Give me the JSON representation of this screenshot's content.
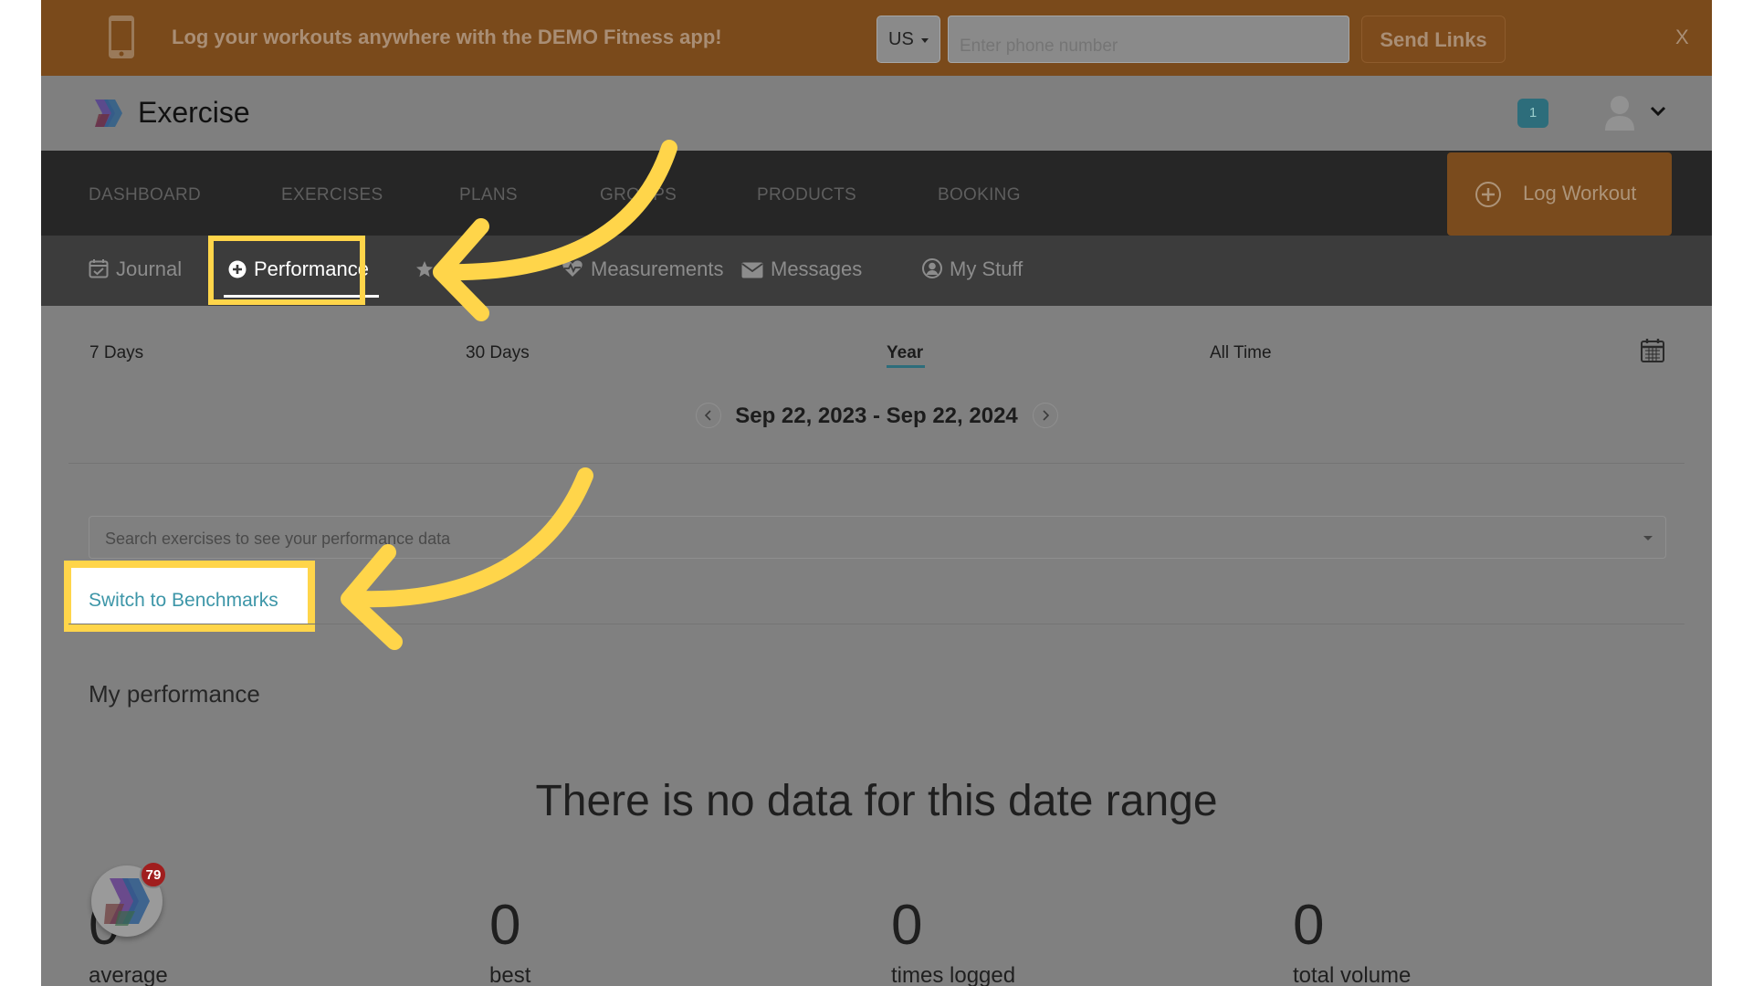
{
  "promo": {
    "text": "Log your workouts anywhere with the DEMO Fitness app!",
    "country": "US",
    "phone_placeholder": "Enter phone number",
    "send_label": "Send Links",
    "close_label": "X"
  },
  "header": {
    "brand": "Exercise",
    "notification_count": "1"
  },
  "main_nav": {
    "items": [
      "DASHBOARD",
      "EXERCISES",
      "PLANS",
      "GROUPS",
      "PRODUCTS",
      "BOOKING"
    ],
    "log_workout": "Log Workout"
  },
  "sub_nav": {
    "tabs": [
      {
        "label": "Journal",
        "icon": "calendar-check-icon"
      },
      {
        "label": "Performance",
        "icon": "plus-circle-icon",
        "active": true
      },
      {
        "label": "",
        "icon": "star-icon"
      },
      {
        "label": "Measurements",
        "icon": "heartbeat-icon"
      },
      {
        "label": "Messages",
        "icon": "envelope-icon"
      },
      {
        "label": "My Stuff",
        "icon": "user-circle-icon"
      }
    ]
  },
  "ranges": {
    "items": [
      "7 Days",
      "30 Days",
      "Year",
      "All Time"
    ],
    "selected": "Year"
  },
  "date_range": "Sep 22, 2023 - Sep 22, 2024",
  "search": {
    "placeholder": "Search exercises to see your performance data"
  },
  "benchmarks_link": "Switch to Benchmarks",
  "my_performance": "My performance",
  "no_data": "There is no data for this date range",
  "stats": [
    {
      "value": "0",
      "label": "average"
    },
    {
      "value": "0",
      "label": "best"
    },
    {
      "value": "0",
      "label": "times logged"
    },
    {
      "value": "0",
      "label": "total volume"
    }
  ],
  "app_badge_count": "79",
  "colors": {
    "promo_bg": "#7a4a1b",
    "accent_teal": "#2d6d7b",
    "highlight_yellow": "#ffd54a",
    "link": "#3d96a8"
  }
}
